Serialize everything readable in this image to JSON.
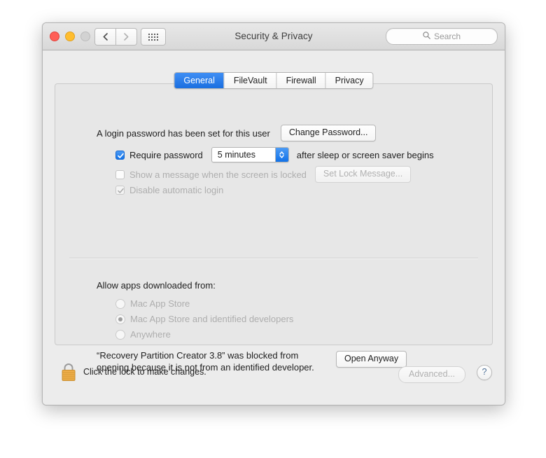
{
  "window": {
    "title": "Security & Privacy",
    "traffic_lights": [
      "close",
      "minimize",
      "zoom"
    ],
    "nav": {
      "back": "back-icon",
      "forward": "forward-icon"
    },
    "show_all": "grid-icon",
    "search": {
      "placeholder": "Search",
      "icon": "search-icon"
    }
  },
  "tabs": [
    {
      "label": "General",
      "active": true
    },
    {
      "label": "FileVault",
      "active": false
    },
    {
      "label": "Firewall",
      "active": false
    },
    {
      "label": "Privacy",
      "active": false
    }
  ],
  "general": {
    "login_password_text": "A login password has been set for this user",
    "change_password_button": "Change Password...",
    "require_password": {
      "label": "Require password",
      "checked": true,
      "interval_value": "5 minutes",
      "suffix": "after sleep or screen saver begins"
    },
    "show_message": {
      "label": "Show a message when the screen is locked",
      "checked": false,
      "button": "Set Lock Message...",
      "disabled": true
    },
    "disable_auto_login": {
      "label": "Disable automatic login",
      "checked": true,
      "disabled": true
    }
  },
  "gatekeeper": {
    "heading": "Allow apps downloaded from:",
    "options": [
      {
        "label": "Mac App Store",
        "selected": false
      },
      {
        "label": "Mac App Store and identified developers",
        "selected": true
      },
      {
        "label": "Anywhere",
        "selected": false
      }
    ],
    "blocked_message": "“Recovery Partition Creator 3.8” was blocked from\nopening because it is not from an identified developer.",
    "open_anyway_button": "Open Anyway"
  },
  "footer": {
    "lock_icon": "lock-closed-icon",
    "lock_text": "Click the lock to make changes.",
    "advanced_button": "Advanced...",
    "help_button": "?"
  },
  "colors": {
    "accent_blue": "#1272e8",
    "window_bg": "#ececec",
    "panel_bg": "#e7e7e7",
    "lock_gold": "#eead4a"
  }
}
